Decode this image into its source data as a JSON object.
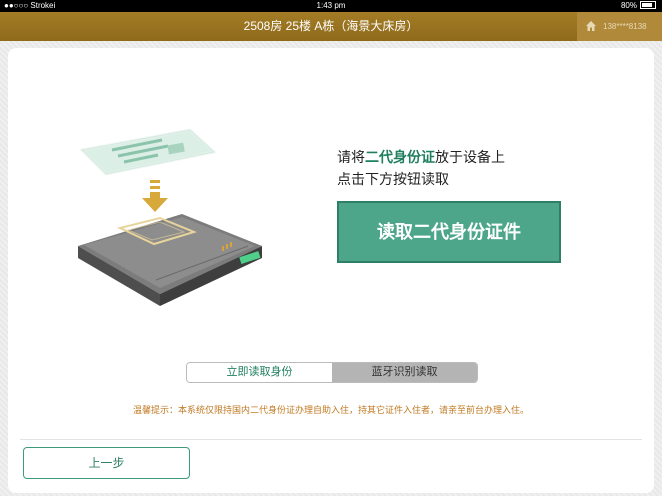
{
  "status_bar": {
    "carrier": "●●○○○ Strokei",
    "time": "1:43 pm",
    "battery": "80%"
  },
  "header": {
    "title": "2508房  25楼  A栋（海景大床房）",
    "user_phone": "138****8138",
    "icons": {
      "home": "home-icon"
    },
    "colors": {
      "bar": "#9a7422",
      "user_box": "#b08a3a"
    }
  },
  "instructions": {
    "part1": "请将",
    "highlight": "二代身份证",
    "part2": "放于设备上",
    "line2": "点击下方按钮读取"
  },
  "read_button": {
    "label": "读取二代身份证件",
    "color": "#4ea68a"
  },
  "mode_tabs": [
    {
      "label": "立即读取身份",
      "selected": true
    },
    {
      "label": "蓝牙识别读取",
      "selected": false
    }
  ],
  "tip": "温馨提示：本系统仅限持国内二代身份证办理自助入住，持其它证件入住者，请亲至前台办理入住。",
  "back_button": {
    "label": "上一步"
  },
  "illustration": {
    "icon": "id-card-reader-illustration"
  }
}
